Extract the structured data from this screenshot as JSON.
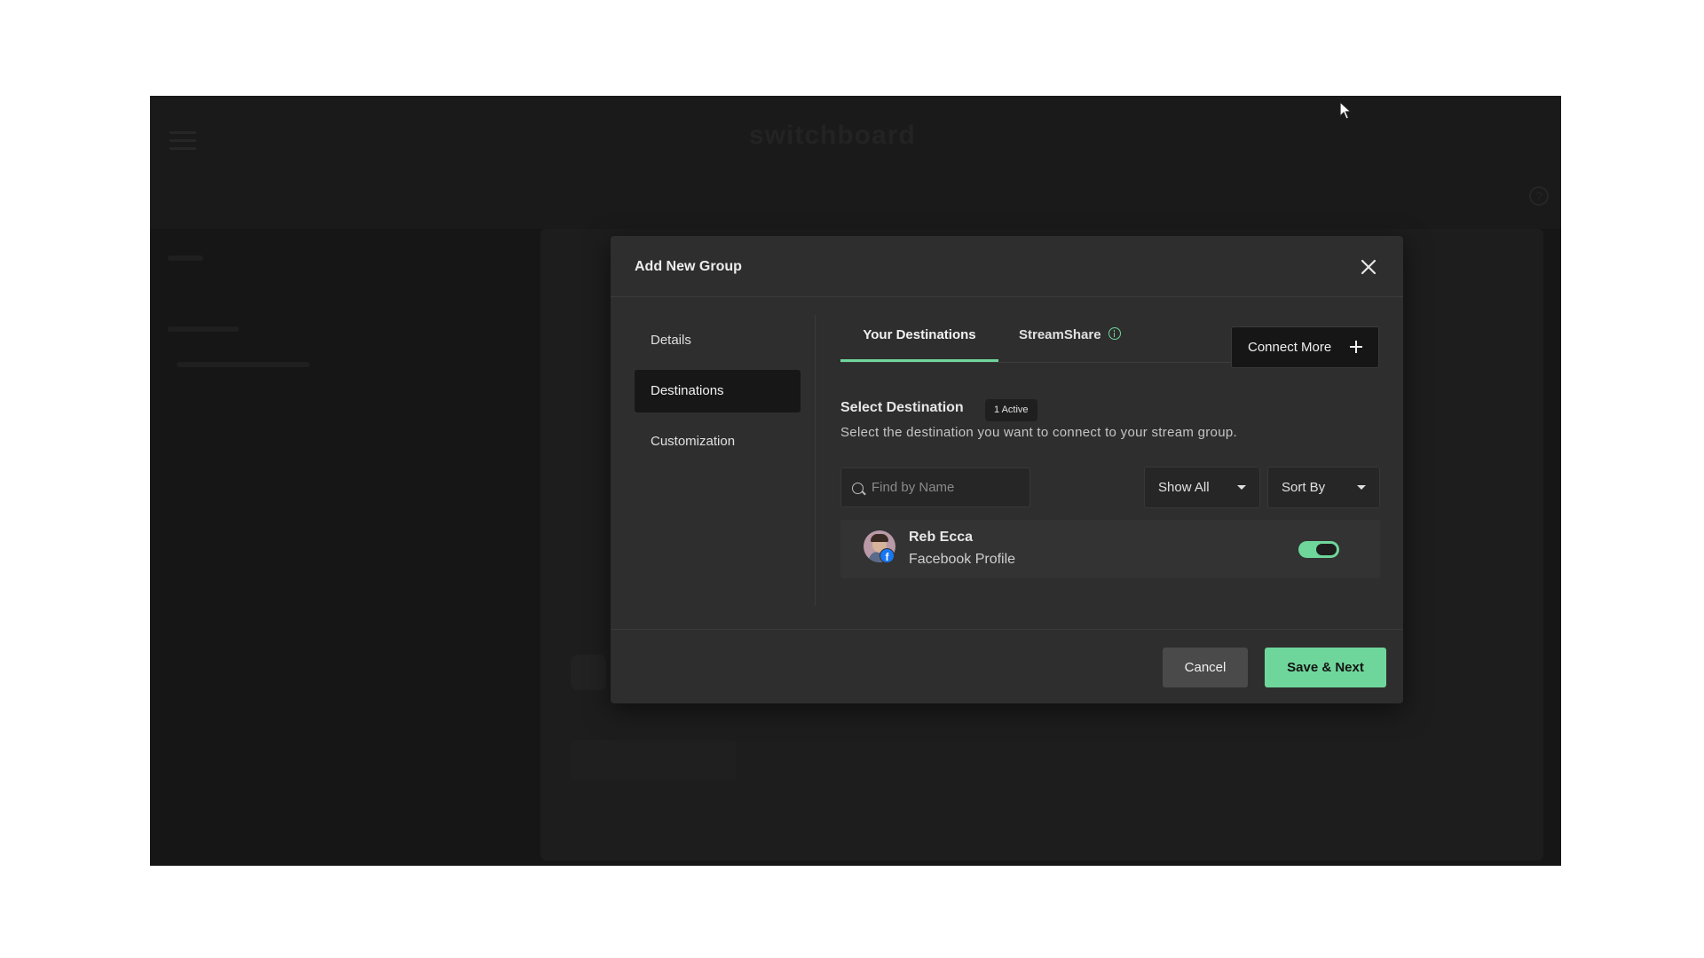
{
  "background": {
    "logo_text": "switchboard",
    "help_icon": "?"
  },
  "modal": {
    "title": "Add New Group",
    "close_icon": "close-icon",
    "nav": [
      {
        "label": "Details"
      },
      {
        "label": "Destinations"
      },
      {
        "label": "Customization"
      }
    ],
    "tabs": {
      "your_destinations": "Your Destinations",
      "streamshare": "StreamShare"
    },
    "connect_more": "Connect More",
    "select_title": "Select Destination",
    "active_badge": "1 Active",
    "select_desc": "Select the destination you want to connect to your stream group.",
    "search_placeholder": "Find by Name",
    "show_all": "Show All",
    "sort_by": "Sort By",
    "destination": {
      "name": "Reb Ecca",
      "type": "Facebook Profile",
      "enabled": true
    },
    "cancel": "Cancel",
    "save_next": "Save & Next"
  },
  "colors": {
    "accent": "#6fd69b",
    "modal_bg": "#2e2e2e",
    "overlay_bg": "#161616",
    "facebook": "#1877f2"
  }
}
